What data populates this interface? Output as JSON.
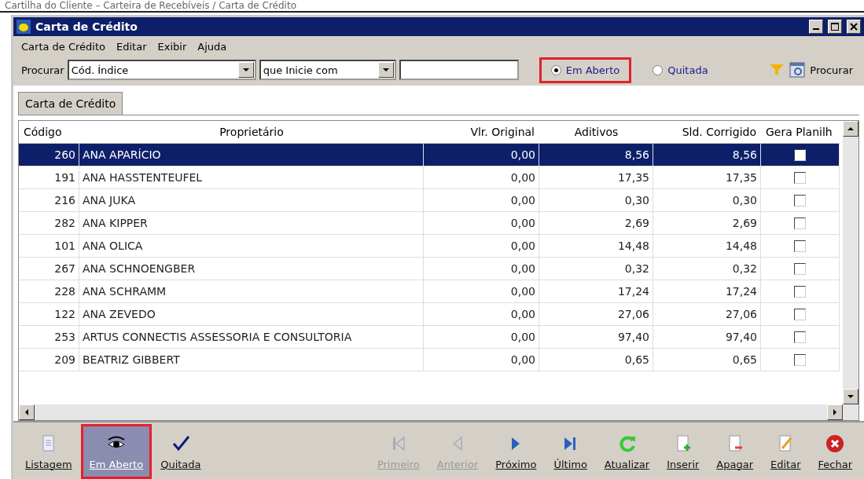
{
  "caption": "Cartilha do Cliente – Carteira de Recebíveis / Carta de Crédito",
  "window": {
    "title": "Carta de Crédito"
  },
  "menu": [
    "Carta de Crédito",
    "Editar",
    "Exibir",
    "Ajuda"
  ],
  "search": {
    "label": "Procurar",
    "field": "Cód. Índice",
    "condition": "que Inicie com",
    "button": "Procurar"
  },
  "status_filter": [
    {
      "label": "Em Aberto",
      "selected": true,
      "highlighted": true
    },
    {
      "label": "Quitada",
      "selected": false,
      "highlighted": false
    }
  ],
  "tabs": [
    {
      "label": "Carta de Crédito",
      "selected": true
    }
  ],
  "table": {
    "columns": [
      "Código",
      "Proprietário",
      "Vlr. Original",
      "Aditivos",
      "Sld. Corrigido",
      "Gera Planilh"
    ],
    "rows": [
      {
        "code": "260",
        "owner": "ANA APARÍCIO",
        "original": "0,00",
        "additives": "8,56",
        "corrected": "8,56",
        "checked": false,
        "selected": true
      },
      {
        "code": "191",
        "owner": "ANA HASSTENTEUFEL",
        "original": "0,00",
        "additives": "17,35",
        "corrected": "17,35",
        "checked": false,
        "selected": false
      },
      {
        "code": "216",
        "owner": "ANA JUKA",
        "original": "0,00",
        "additives": "0,30",
        "corrected": "0,30",
        "checked": false,
        "selected": false
      },
      {
        "code": "282",
        "owner": "ANA KIPPER",
        "original": "0,00",
        "additives": "2,69",
        "corrected": "2,69",
        "checked": false,
        "selected": false
      },
      {
        "code": "101",
        "owner": "ANA OLICA",
        "original": "0,00",
        "additives": "14,48",
        "corrected": "14,48",
        "checked": false,
        "selected": false
      },
      {
        "code": "267",
        "owner": "ANA SCHNOENGBER",
        "original": "0,00",
        "additives": "0,32",
        "corrected": "0,32",
        "checked": false,
        "selected": false
      },
      {
        "code": "228",
        "owner": "ANA SCHRAMM",
        "original": "0,00",
        "additives": "17,24",
        "corrected": "17,24",
        "checked": false,
        "selected": false
      },
      {
        "code": "122",
        "owner": "ANA ZEVEDO",
        "original": "0,00",
        "additives": "27,06",
        "corrected": "27,06",
        "checked": false,
        "selected": false
      },
      {
        "code": "253",
        "owner": "ARTUS CONNECTIS ASSESSORIA E CONSULTORIA",
        "original": "0,00",
        "additives": "97,40",
        "corrected": "97,40",
        "checked": false,
        "selected": false
      },
      {
        "code": "209",
        "owner": "BEATRIZ GIBBERT",
        "original": "0,00",
        "additives": "0,65",
        "corrected": "0,65",
        "checked": false,
        "selected": false
      }
    ]
  },
  "toolbar": [
    {
      "kind": "list",
      "label": "Listagem",
      "disabled": false,
      "selected": false,
      "highlighted": false
    },
    {
      "kind": "eye",
      "label": "Em Aberto",
      "disabled": false,
      "selected": true,
      "highlighted": true
    },
    {
      "kind": "check",
      "label": "Quitada",
      "disabled": false,
      "selected": false,
      "highlighted": false
    },
    {
      "kind": "spacer"
    },
    {
      "kind": "first",
      "label": "Primeiro",
      "disabled": true,
      "selected": false,
      "highlighted": false
    },
    {
      "kind": "prev",
      "label": "Anterior",
      "disabled": true,
      "selected": false,
      "highlighted": false
    },
    {
      "kind": "next",
      "label": "Próximo",
      "disabled": false,
      "selected": false,
      "highlighted": false
    },
    {
      "kind": "last",
      "label": "Último",
      "disabled": false,
      "selected": false,
      "highlighted": false
    },
    {
      "kind": "refresh",
      "label": "Atualizar",
      "disabled": false,
      "selected": false,
      "highlighted": false
    },
    {
      "kind": "insert",
      "label": "Inserir",
      "disabled": false,
      "selected": false,
      "highlighted": false
    },
    {
      "kind": "delete",
      "label": "Apagar",
      "disabled": false,
      "selected": false,
      "highlighted": false
    },
    {
      "kind": "edit",
      "label": "Editar",
      "disabled": false,
      "selected": false,
      "highlighted": false
    },
    {
      "kind": "close",
      "label": "Fechar",
      "disabled": false,
      "selected": false,
      "highlighted": false
    }
  ]
}
